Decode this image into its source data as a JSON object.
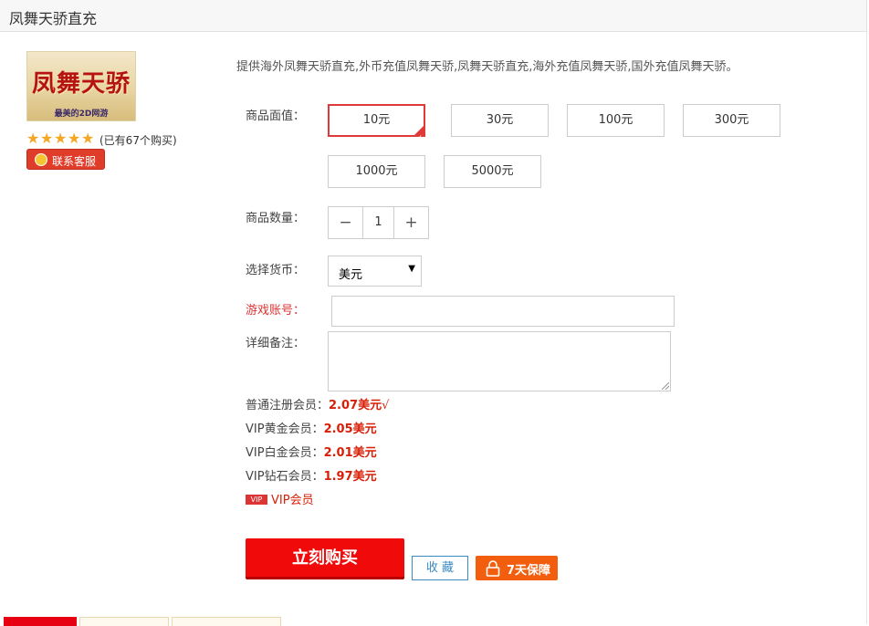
{
  "page_title": "凤舞天骄直充",
  "logo": {
    "text": "凤舞天骄",
    "subtitle": "最美的2D网游"
  },
  "rating": {
    "stars": 5,
    "note": "(已有67个购买)"
  },
  "contact_button": "联系客服",
  "description": "提供海外凤舞天骄直充,外币充值凤舞天骄,凤舞天骄直充,海外充值凤舞天骄,国外充值凤舞天骄。",
  "labels": {
    "denomination": "商品面值：",
    "quantity": "商品数量：",
    "currency": "选择货币：",
    "account": "游戏账号：",
    "notes": "详细备注："
  },
  "denominations": [
    {
      "label": "10元",
      "selected": true
    },
    {
      "label": "30元",
      "selected": false
    },
    {
      "label": "100元",
      "selected": false
    },
    {
      "label": "300元",
      "selected": false
    },
    {
      "label": "1000元",
      "selected": false
    },
    {
      "label": "5000元",
      "selected": false
    }
  ],
  "quantity": {
    "minus": "−",
    "value": "1",
    "plus": "+"
  },
  "currency": {
    "selected": "美元",
    "caret": "▼"
  },
  "account_input": {
    "value": "",
    "placeholder": ""
  },
  "notes_input": {
    "value": "",
    "placeholder": ""
  },
  "prices": [
    {
      "label": "普通注册会员：",
      "value": "2.07美元",
      "mark": "√"
    },
    {
      "label": "VIP黄金会员：",
      "value": "2.05美元",
      "mark": ""
    },
    {
      "label": "VIP白金会员：",
      "value": "2.01美元",
      "mark": ""
    },
    {
      "label": "VIP钻石会员：",
      "value": "1.97美元",
      "mark": ""
    }
  ],
  "vip": {
    "badge": "VIP",
    "label": "VIP会员"
  },
  "buy_button": "立刻购买",
  "favorite_button": "收 藏",
  "guarantee_button": "7天保障",
  "colors": {
    "accent_red": "#e60012",
    "link_blue": "#3a8ac4",
    "orange": "#f25e0d"
  }
}
